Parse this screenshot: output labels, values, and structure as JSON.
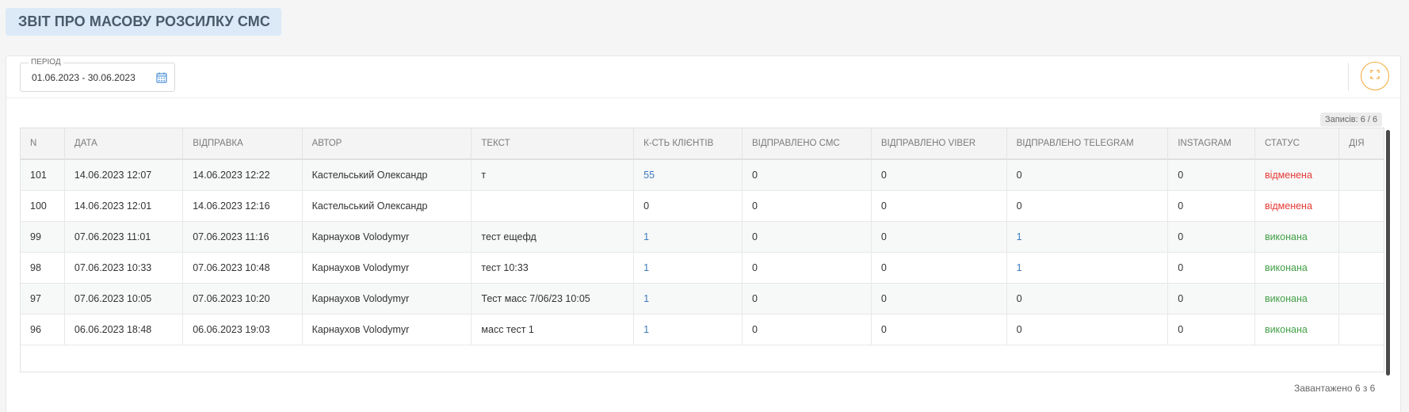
{
  "page": {
    "title": "ЗВІТ ПРО МАСОВУ РОЗСИЛКУ СМС"
  },
  "filters": {
    "period_label": "ПЕРІОД",
    "period_value": "01.06.2023 - 30.06.2023"
  },
  "records_badge": "Записів: 6 / 6",
  "loaded_text": "Завантажено 6 з 6",
  "colors": {
    "accent": "#f0a93a",
    "title_bg": "#dceaf7",
    "status_cancelled": "#e53935",
    "status_done": "#43a047",
    "link_value": "#3b7bbf"
  },
  "icons": {
    "period": "calendar-icon",
    "fullscreen": "expand-icon"
  },
  "table": {
    "columns": [
      "N",
      "ДАТА",
      "ВІДПРАВКА",
      "АВТОР",
      "ТЕКСТ",
      "К-СТЬ КЛІЄНТІВ",
      "ВІДПРАВЛЕНО СМС",
      "ВІДПРАВЛЕНО VIBER",
      "ВІДПРАВЛЕНО TELEGRAM",
      "INSTAGRAM",
      "СТАТУС",
      "ДІЯ"
    ],
    "rows": [
      {
        "n": "101",
        "date": "14.06.2023 12:07",
        "sent": "14.06.2023 12:22",
        "author": "Кастельський Олександр",
        "text": "т",
        "clients": "55",
        "sms": "0",
        "viber": "0",
        "telegram": "0",
        "instagram": "0",
        "status": "відменена",
        "status_type": "cancelled"
      },
      {
        "n": "100",
        "date": "14.06.2023 12:01",
        "sent": "14.06.2023 12:16",
        "author": "Кастельський Олександр",
        "text": "",
        "clients": "0",
        "sms": "0",
        "viber": "0",
        "telegram": "0",
        "instagram": "0",
        "status": "відменена",
        "status_type": "cancelled"
      },
      {
        "n": "99",
        "date": "07.06.2023 11:01",
        "sent": "07.06.2023 11:16",
        "author": "Карнаухов Volodymyr",
        "text": "тест ещефд",
        "clients": "1",
        "sms": "0",
        "viber": "0",
        "telegram": "1",
        "instagram": "0",
        "status": "виконана",
        "status_type": "done"
      },
      {
        "n": "98",
        "date": "07.06.2023 10:33",
        "sent": "07.06.2023 10:48",
        "author": "Карнаухов Volodymyr",
        "text": "тест 10:33",
        "clients": "1",
        "sms": "0",
        "viber": "0",
        "telegram": "1",
        "instagram": "0",
        "status": "виконана",
        "status_type": "done"
      },
      {
        "n": "97",
        "date": "07.06.2023 10:05",
        "sent": "07.06.2023 10:20",
        "author": "Карнаухов Volodymyr",
        "text": "Тест масс 7/06/23 10:05",
        "clients": "1",
        "sms": "0",
        "viber": "0",
        "telegram": "0",
        "instagram": "0",
        "status": "виконана",
        "status_type": "done"
      },
      {
        "n": "96",
        "date": "06.06.2023 18:48",
        "sent": "06.06.2023 19:03",
        "author": "Карнаухов Volodymyr",
        "text": "масс тест 1",
        "clients": "1",
        "sms": "0",
        "viber": "0",
        "telegram": "0",
        "instagram": "0",
        "status": "виконана",
        "status_type": "done"
      }
    ]
  }
}
